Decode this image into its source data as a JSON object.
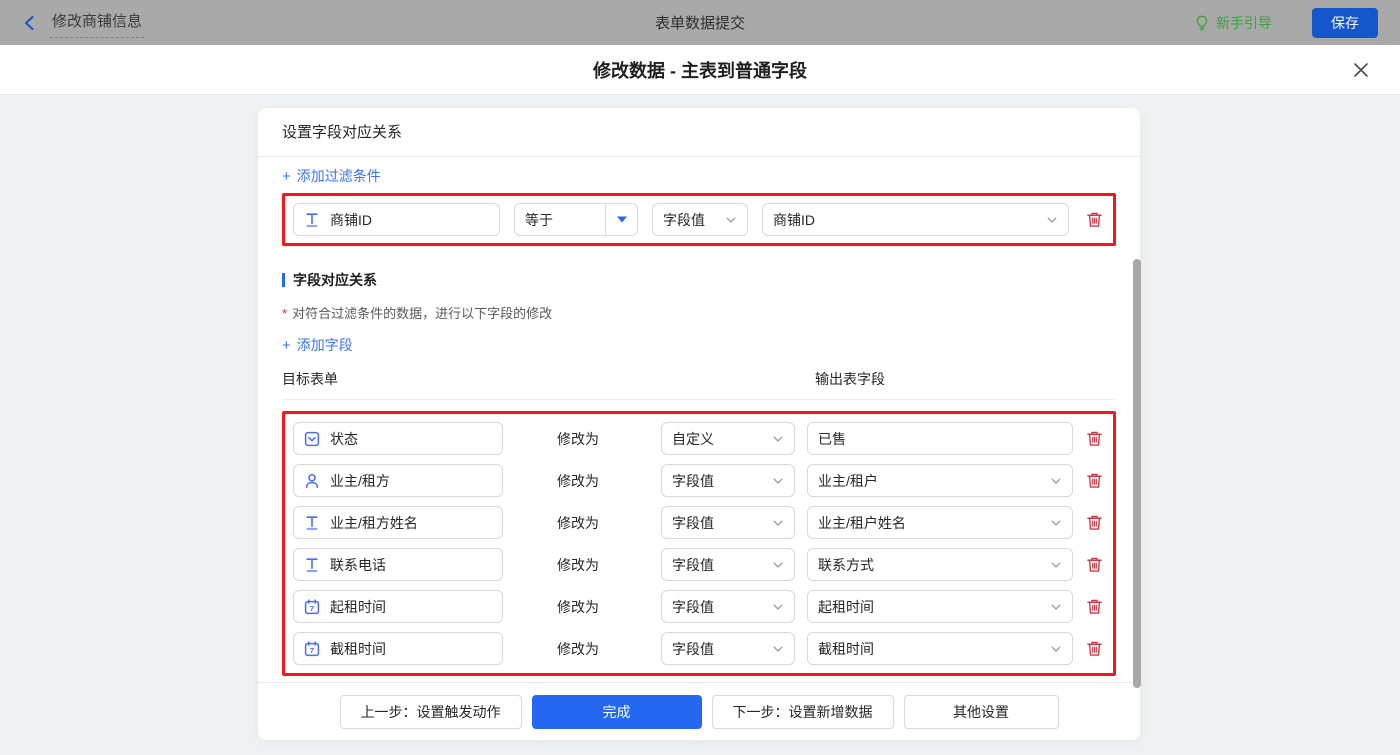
{
  "colors": {
    "accent_blue": "#2468f2",
    "link_blue": "#3a74f4",
    "field_icon_blue": "#466df4",
    "danger_red": "#f5161b",
    "trash_red": "#cd3a47",
    "guide_green": "#3f9f3f",
    "save_blue": "#1456cc",
    "topbar_gray": "#a9a9a9"
  },
  "topbar": {
    "back_label": "修改商铺信息",
    "center_title": "表单数据提交",
    "guide_label": "新手引导",
    "save_label": "保存"
  },
  "modal": {
    "title": "修改数据 - 主表到普通字段"
  },
  "card": {
    "header": "设置字段对应关系",
    "add_filter": {
      "plus": "+",
      "label": "添加过滤条件"
    },
    "filter": {
      "field_icon": "text-icon",
      "field_label": "商铺ID",
      "operator": "等于",
      "value_type": "字段值",
      "value_field": "商铺ID"
    },
    "section": {
      "title": "字段对应关系",
      "asterisk": "*",
      "note": "对符合过滤条件的数据，进行以下字段的修改",
      "add_field": {
        "plus": "+",
        "label": "添加字段"
      },
      "col_left": "目标表单",
      "col_right": "输出表字段"
    },
    "rows": [
      {
        "icon": "select-icon",
        "target": "状态",
        "action": "修改为",
        "type": "自定义",
        "value": "已售",
        "value_kind": "input"
      },
      {
        "icon": "user-icon",
        "target": "业主/租方",
        "action": "修改为",
        "type": "字段值",
        "value": "业主/租户",
        "value_kind": "select"
      },
      {
        "icon": "text-icon",
        "target": "业主/租方姓名",
        "action": "修改为",
        "type": "字段值",
        "value": "业主/租户姓名",
        "value_kind": "select"
      },
      {
        "icon": "text-icon",
        "target": "联系电话",
        "action": "修改为",
        "type": "字段值",
        "value": "联系方式",
        "value_kind": "select"
      },
      {
        "icon": "date-icon",
        "target": "起租时间",
        "action": "修改为",
        "type": "字段值",
        "value": "起租时间",
        "value_kind": "select"
      },
      {
        "icon": "date-icon",
        "target": "截租时间",
        "action": "修改为",
        "type": "字段值",
        "value": "截租时间",
        "value_kind": "select"
      }
    ],
    "footer": {
      "prev": "上一步：设置触发动作",
      "done": "完成",
      "next": "下一步：设置新增数据",
      "other": "其他设置"
    }
  }
}
